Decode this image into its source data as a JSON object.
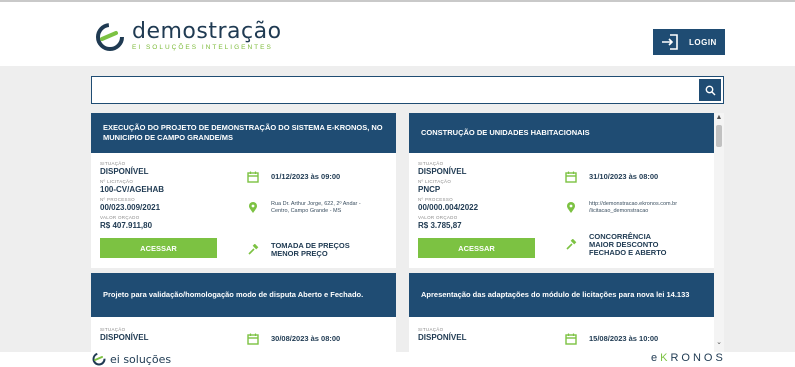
{
  "header": {
    "logo_title": "demostração",
    "logo_subtitle": "EI SOLUÇÕES INTELIGENTES",
    "login_label": "LOGIN"
  },
  "search": {
    "placeholder": "",
    "value": ""
  },
  "cards": [
    {
      "title": "EXECUÇÃO DO PROJETO DE DEMONSTRAÇÃO DO SISTEMA E-KRONOS, NO MUNICIPIO DE CAMPO GRANDE/MS",
      "situacao_label": "SITUAÇÃO",
      "situacao": "DISPONÍVEL",
      "licitacao_label": "Nº LICITAÇÃO",
      "licitacao": "100-CV/AGEHAB",
      "processo_label": "Nº PROCESSO",
      "processo": "00/023.009/2021",
      "valor_label": "VALOR ORÇADO",
      "valor": "R$ 407.911,80",
      "data": "01/12/2023 às 09:00",
      "local_line1": "Rua Dr. Arthur Jorge, 622, 2º Andar -",
      "local_line2": "Centro, Campo Grande - MS",
      "modalidade_line1": "TOMADA DE PREÇOS",
      "modalidade_line2": "MENOR PREÇO",
      "acessar": "ACESSAR"
    },
    {
      "title": "CONSTRUÇÃO DE UNIDADES HABITACIONAIS",
      "situacao_label": "SITUAÇÃO",
      "situacao": "DISPONÍVEL",
      "licitacao_label": "Nº LICITAÇÃO",
      "licitacao": "PNCP",
      "processo_label": "Nº PROCESSO",
      "processo": "00/000.004/2022",
      "valor_label": "VALOR ORÇADO",
      "valor": "R$ 3.785,87",
      "data": "31/10/2023 às 08:00",
      "local_line1": "http://demonstracao.ekronos.com.br",
      "local_line2": "/licitacao_demonstracao",
      "modalidade_line1": "CONCORRÊNCIA",
      "modalidade_line2": "MAIOR DESCONTO",
      "modalidade_line3": "FECHADO E ABERTO",
      "acessar": "ACESSAR"
    },
    {
      "title": "Projeto para validação/homologação modo de disputa Aberto e Fechado.",
      "situacao_label": "SITUAÇÃO",
      "situacao": "DISPONÍVEL",
      "data": "30/08/2023 às 08:00"
    },
    {
      "title": "Apresentação das adaptações do módulo de licitações para nova lei 14.133",
      "situacao_label": "SITUAÇÃO",
      "situacao": "DISPONÍVEL",
      "data": "15/08/2023 às 10:00"
    }
  ],
  "footer": {
    "left_brand": "ei soluções",
    "right_brand_pre": "e",
    "right_brand_k": "K",
    "right_brand_post": "RONOS"
  },
  "colors": {
    "primary": "#1f4c73",
    "accent_green": "#7cc242",
    "background": "#eeeeee"
  }
}
